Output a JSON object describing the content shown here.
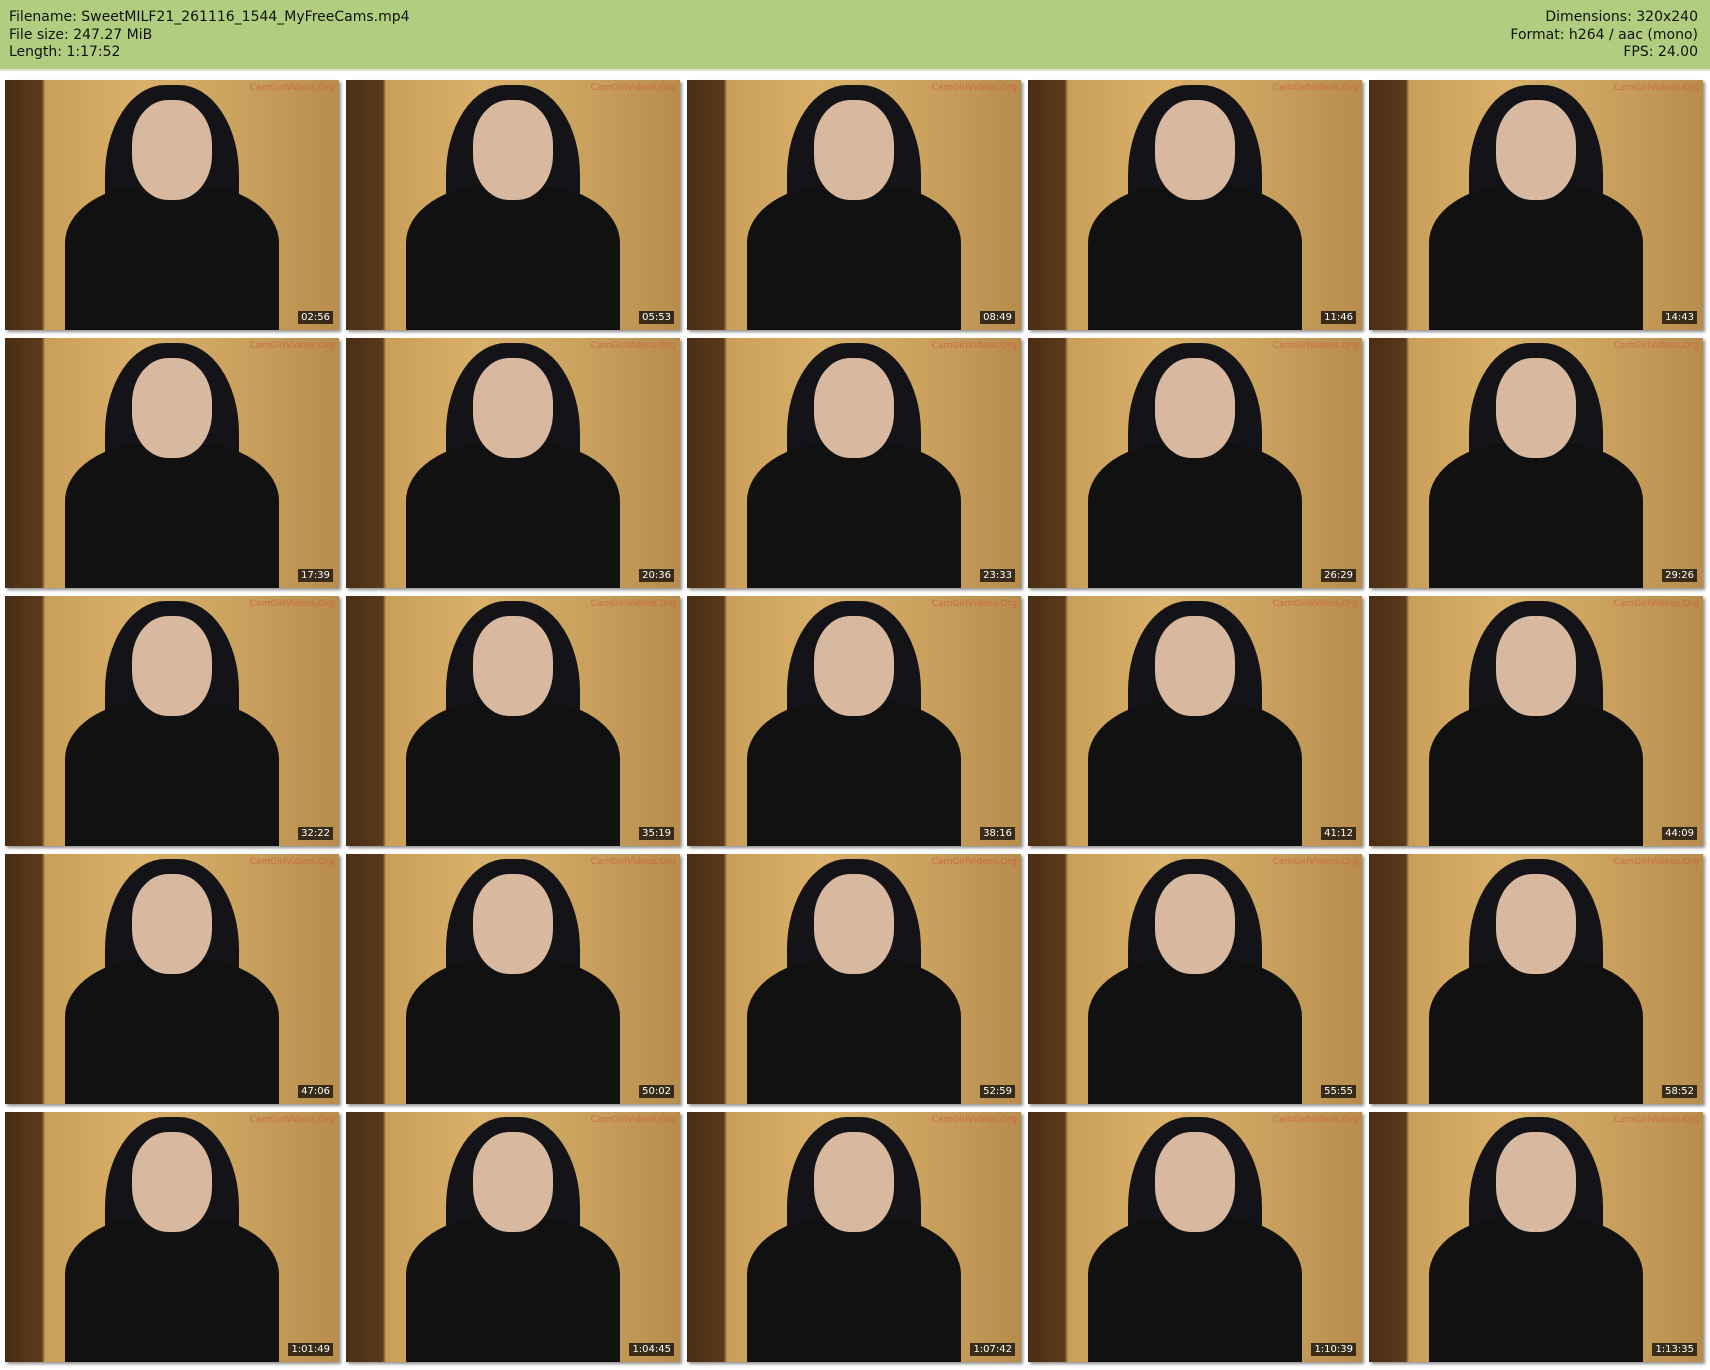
{
  "header": {
    "filename": "Filename: SweetMILF21_261116_1544_MyFreeCams.mp4",
    "filesize": "File size: 247.27 MiB",
    "length": "Length: 1:17:52",
    "dimensions": "Dimensions: 320x240",
    "format": "Format: h264 / aac (mono)",
    "fps": "FPS: 24.00"
  },
  "watermark": "CamGirlVideos.Org",
  "thumbnails": [
    {
      "time": "02:56"
    },
    {
      "time": "05:53"
    },
    {
      "time": "08:49"
    },
    {
      "time": "11:46"
    },
    {
      "time": "14:43"
    },
    {
      "time": "17:39"
    },
    {
      "time": "20:36"
    },
    {
      "time": "23:33"
    },
    {
      "time": "26:29"
    },
    {
      "time": "29:26"
    },
    {
      "time": "32:22"
    },
    {
      "time": "35:19"
    },
    {
      "time": "38:16"
    },
    {
      "time": "41:12"
    },
    {
      "time": "44:09"
    },
    {
      "time": "47:06"
    },
    {
      "time": "50:02"
    },
    {
      "time": "52:59"
    },
    {
      "time": "55:55"
    },
    {
      "time": "58:52"
    },
    {
      "time": "1:01:49"
    },
    {
      "time": "1:04:45"
    },
    {
      "time": "1:07:42"
    },
    {
      "time": "1:10:39"
    },
    {
      "time": "1:13:35"
    }
  ]
}
